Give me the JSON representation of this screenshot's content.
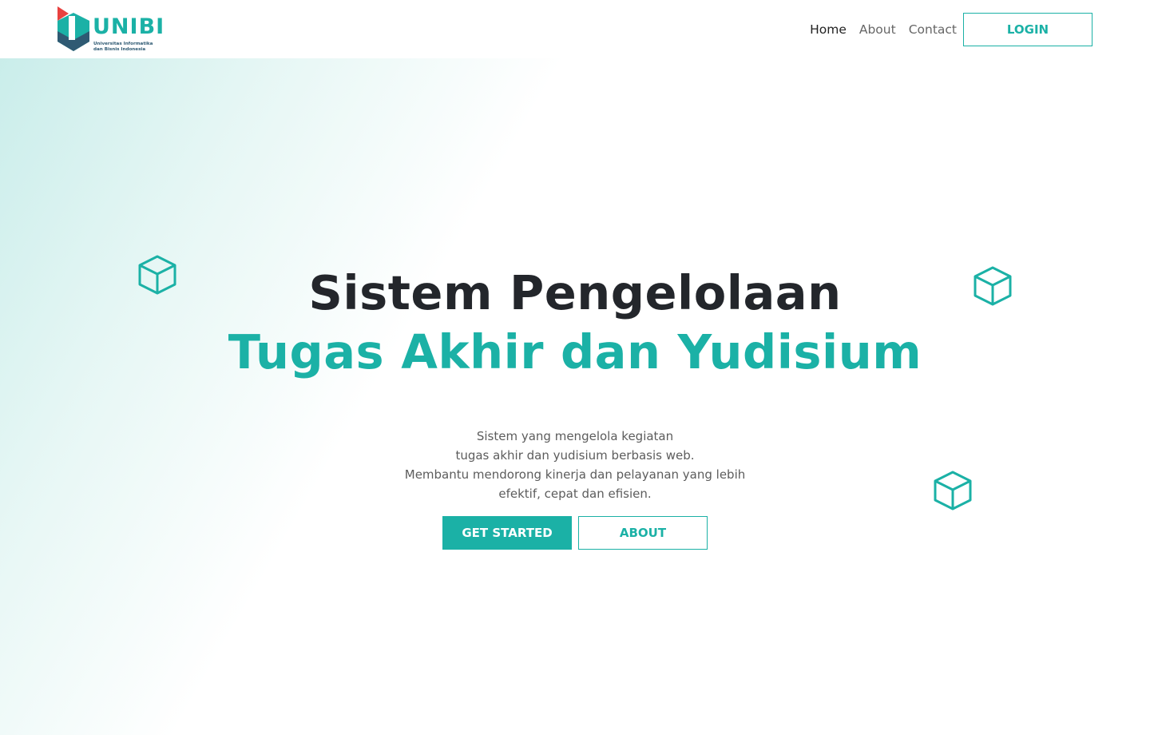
{
  "brand": {
    "name": "UNIBI",
    "subtitle_line1": "Universitas Informatika",
    "subtitle_line2": "dan Bisnis Indonesia",
    "colors": {
      "teal": "#1bb1a6",
      "navy": "#2f5a73",
      "red": "#e8413f",
      "dark_text": "#23262b"
    }
  },
  "nav": {
    "items": [
      {
        "label": "Home",
        "active": true
      },
      {
        "label": "About",
        "active": false
      },
      {
        "label": "Contact",
        "active": false
      }
    ],
    "login_label": "LOGIN"
  },
  "hero": {
    "title_line1": "Sistem Pengelolaan",
    "title_line2": "Tugas Akhir dan Yudisium",
    "description": [
      "Sistem yang mengelola kegiatan",
      "tugas akhir dan yudisium berbasis web.",
      "Membantu mendorong kinerja dan pelayanan yang lebih",
      "efektif, cepat dan efisien."
    ],
    "primary_button": "GET STARTED",
    "secondary_button": "ABOUT"
  },
  "decorations": {
    "icon": "cube-icon"
  }
}
